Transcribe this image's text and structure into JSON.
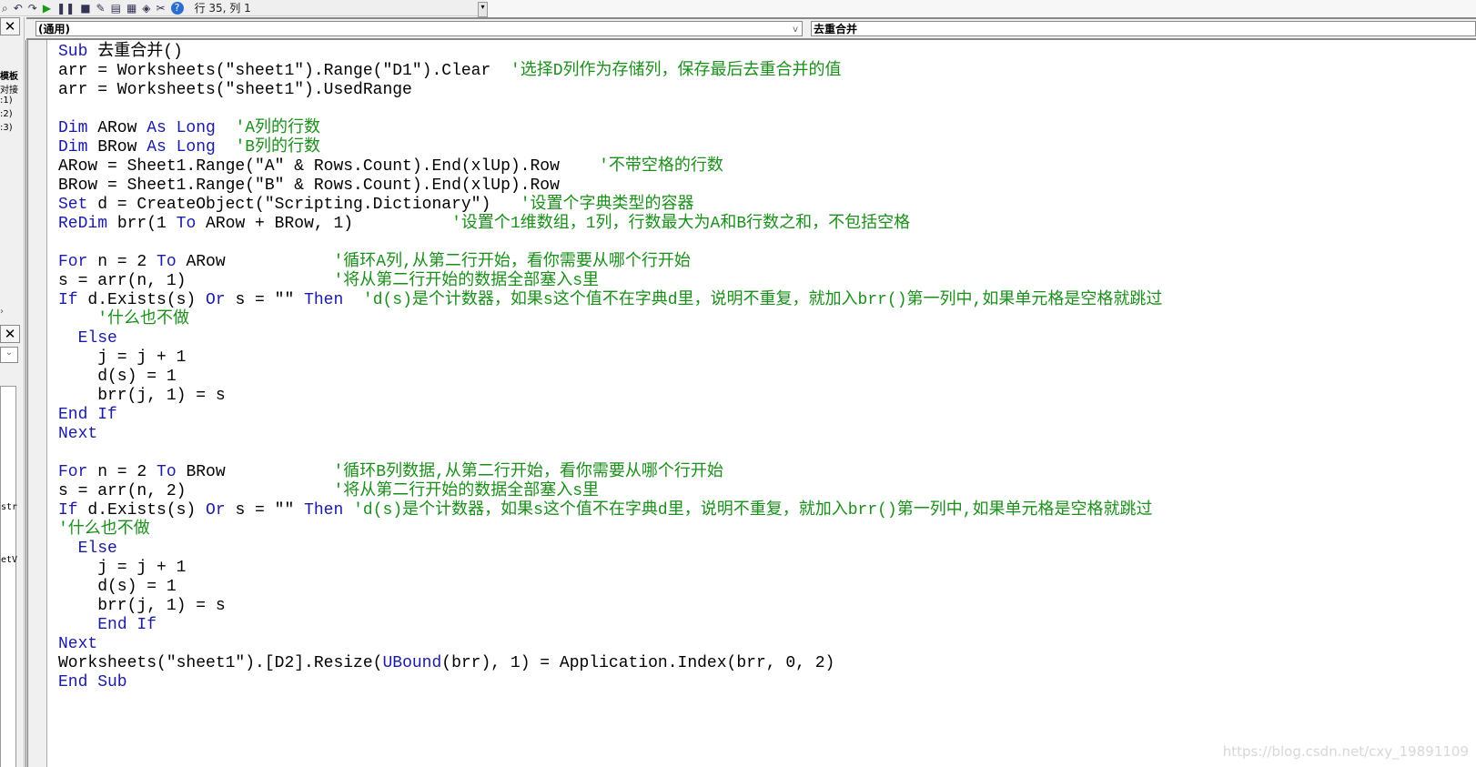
{
  "toolbar": {
    "icons": [
      "find-icon",
      "undo-icon",
      "redo-icon",
      "run-icon",
      "break-icon",
      "reset-icon",
      "design-mode-icon",
      "project-explorer-icon",
      "properties-icon",
      "object-browser-icon",
      "toolbox-icon",
      "help-icon"
    ],
    "cursor_position": "行 35, 列 1"
  },
  "left_panel": {
    "labels": [
      "模板",
      "对接",
      ":1)",
      ":2)",
      ":3)",
      "str",
      "etV"
    ]
  },
  "dropdowns": {
    "object": "(通用)",
    "procedure": "去重合并"
  },
  "colors": {
    "keyword": "#1a1aa6",
    "comment": "#1a8f1a",
    "text": "#000000"
  },
  "code_lines": [
    [
      [
        "kw",
        "Sub"
      ],
      [
        "t",
        " 去重合并()"
      ]
    ],
    [
      [
        "t",
        "arr = Worksheets(\"sheet1\").Range(\"D1\").Clear  "
      ],
      [
        "cm",
        "'选择D列作为存储列，保存最后去重合并的值"
      ]
    ],
    [
      [
        "t",
        "arr = Worksheets(\"sheet1\").UsedRange"
      ]
    ],
    [],
    [
      [
        "kw",
        "Dim"
      ],
      [
        "t",
        " ARow "
      ],
      [
        "kw",
        "As Long"
      ],
      [
        "t",
        "  "
      ],
      [
        "cm",
        "'A列的行数"
      ]
    ],
    [
      [
        "kw",
        "Dim"
      ],
      [
        "t",
        " BRow "
      ],
      [
        "kw",
        "As Long"
      ],
      [
        "t",
        "  "
      ],
      [
        "cm",
        "'B列的行数"
      ]
    ],
    [
      [
        "t",
        "ARow = Sheet1.Range(\"A\" & Rows.Count).End(xlUp).Row    "
      ],
      [
        "cm",
        "'不带空格的行数"
      ]
    ],
    [
      [
        "t",
        "BRow = Sheet1.Range(\"B\" & Rows.Count).End(xlUp).Row"
      ]
    ],
    [
      [
        "kw",
        "Set"
      ],
      [
        "t",
        " d = CreateObject(\"Scripting.Dictionary\")   "
      ],
      [
        "cm",
        "'设置个字典类型的容器"
      ]
    ],
    [
      [
        "kw",
        "ReDim"
      ],
      [
        "t",
        " brr(1 "
      ],
      [
        "kw",
        "To"
      ],
      [
        "t",
        " ARow + BRow, 1)          "
      ],
      [
        "cm",
        "'设置个1维数组，1列，行数最大为A和B行数之和，不包括空格"
      ]
    ],
    [],
    [
      [
        "kw",
        "For"
      ],
      [
        "t",
        " n = 2 "
      ],
      [
        "kw",
        "To"
      ],
      [
        "t",
        " ARow           "
      ],
      [
        "cm",
        "'循环A列,从第二行开始，看你需要从哪个行开始"
      ]
    ],
    [
      [
        "t",
        "s = arr(n, 1)               "
      ],
      [
        "cm",
        "'将从第二行开始的数据全部塞入s里"
      ]
    ],
    [
      [
        "kw",
        "If"
      ],
      [
        "t",
        " d.Exists(s) "
      ],
      [
        "kw",
        "Or"
      ],
      [
        "t",
        " s = \"\" "
      ],
      [
        "kw",
        "Then"
      ],
      [
        "t",
        "  "
      ],
      [
        "cm",
        "'d(s)是个计数器，如果s这个值不在字典d里，说明不重复，就加入brr()第一列中,如果单元格是空格就跳过"
      ]
    ],
    [
      [
        "t",
        "    "
      ],
      [
        "cm",
        "'什么也不做"
      ]
    ],
    [
      [
        "t",
        "  "
      ],
      [
        "kw",
        "Else"
      ]
    ],
    [
      [
        "t",
        "    j = j + 1"
      ]
    ],
    [
      [
        "t",
        "    d(s) = 1"
      ]
    ],
    [
      [
        "t",
        "    brr(j, 1) = s"
      ]
    ],
    [
      [
        "kw",
        "End If"
      ]
    ],
    [
      [
        "kw",
        "Next"
      ]
    ],
    [],
    [
      [
        "kw",
        "For"
      ],
      [
        "t",
        " n = 2 "
      ],
      [
        "kw",
        "To"
      ],
      [
        "t",
        " BRow           "
      ],
      [
        "cm",
        "'循环B列数据,从第二行开始，看你需要从哪个行开始"
      ]
    ],
    [
      [
        "t",
        "s = arr(n, 2)               "
      ],
      [
        "cm",
        "'将从第二行开始的数据全部塞入s里"
      ]
    ],
    [
      [
        "kw",
        "If"
      ],
      [
        "t",
        " d.Exists(s) "
      ],
      [
        "kw",
        "Or"
      ],
      [
        "t",
        " s = \"\" "
      ],
      [
        "kw",
        "Then"
      ],
      [
        "t",
        " "
      ],
      [
        "cm",
        "'d(s)是个计数器，如果s这个值不在字典d里，说明不重复，就加入brr()第一列中,如果单元格是空格就跳过"
      ]
    ],
    [
      [
        "cm",
        "'什么也不做"
      ]
    ],
    [
      [
        "t",
        "  "
      ],
      [
        "kw",
        "Else"
      ]
    ],
    [
      [
        "t",
        "    j = j + 1"
      ]
    ],
    [
      [
        "t",
        "    d(s) = 1"
      ]
    ],
    [
      [
        "t",
        "    brr(j, 1) = s"
      ]
    ],
    [
      [
        "t",
        "    "
      ],
      [
        "kw",
        "End If"
      ]
    ],
    [
      [
        "kw",
        "Next"
      ]
    ],
    [
      [
        "t",
        "Worksheets(\"sheet1\").[D2].Resize("
      ],
      [
        "kw",
        "UBound"
      ],
      [
        "t",
        "(brr), 1) = Application.Index(brr, 0, 2)"
      ]
    ],
    [
      [
        "kw",
        "End Sub"
      ]
    ]
  ],
  "watermark": "https://blog.csdn.net/cxy_19891109"
}
